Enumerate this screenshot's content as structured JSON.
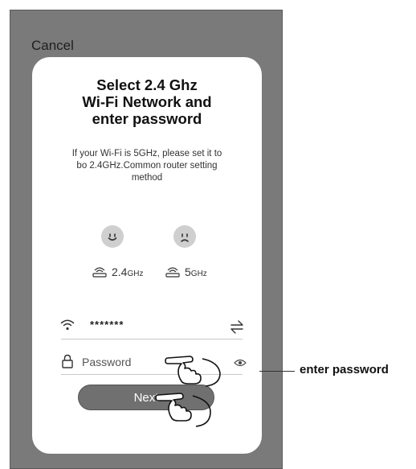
{
  "header": {
    "cancel_label": "Cancel"
  },
  "card": {
    "title_lines": [
      "Select 2.4 Ghz",
      "Wi-Fi Network and",
      "enter password"
    ],
    "subtitle_lines": [
      "If your Wi-Fi is 5GHz, please set it to",
      "bo 2.4GHz.Common router setting",
      "method"
    ],
    "bands": [
      {
        "value": "2.4",
        "unit": "GHz",
        "face_icon": "smile-face-icon",
        "router_icon": "router-icon"
      },
      {
        "value": "5",
        "unit": "GHz",
        "face_icon": "sad-face-icon",
        "router_icon": "router-icon"
      }
    ],
    "network": {
      "ssid_value": "*******",
      "icon": "wifi-icon",
      "switch_icon": "switch-network-icon"
    },
    "password": {
      "placeholder": "Password",
      "value": "",
      "icon": "lock-icon",
      "reveal_icon": "eye-icon"
    },
    "next_label": "Next"
  },
  "callout": {
    "label": "enter password"
  },
  "colors": {
    "phone_bg": "#7a7a7a",
    "card_bg": "#ffffff",
    "button_bg": "#707070"
  }
}
